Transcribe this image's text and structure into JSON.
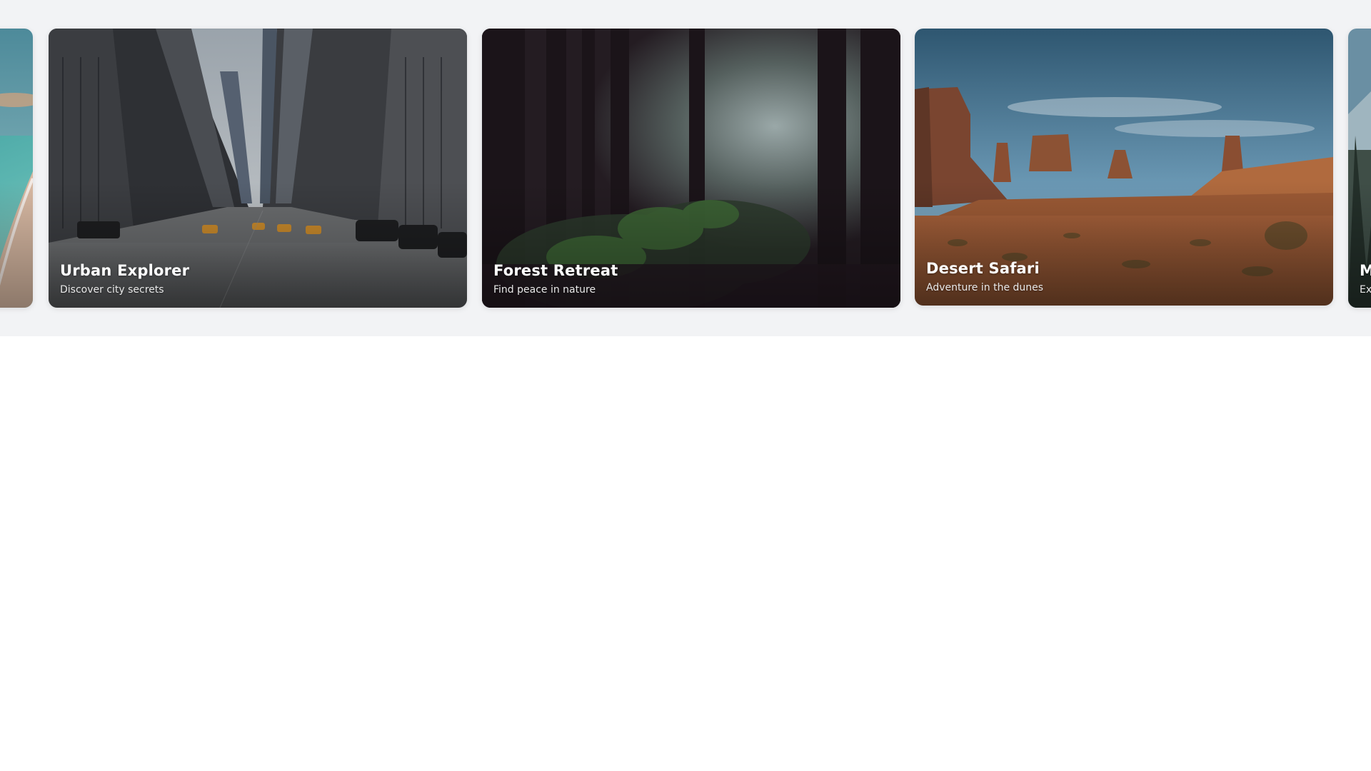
{
  "carousel": {
    "cards": [
      {
        "title": "",
        "subtitle": "",
        "image": "beach-ocean-photo"
      },
      {
        "title": "Urban Explorer",
        "subtitle": "Discover city secrets",
        "image": "city-street-photo"
      },
      {
        "title": "Forest Retreat",
        "subtitle": "Find peace in nature",
        "image": "misty-forest-photo"
      },
      {
        "title": "Desert Safari",
        "subtitle": "Adventure in the dunes",
        "image": "desert-buttes-photo"
      },
      {
        "title": "M",
        "subtitle": "Ex",
        "image": "mountain-photo"
      }
    ]
  }
}
